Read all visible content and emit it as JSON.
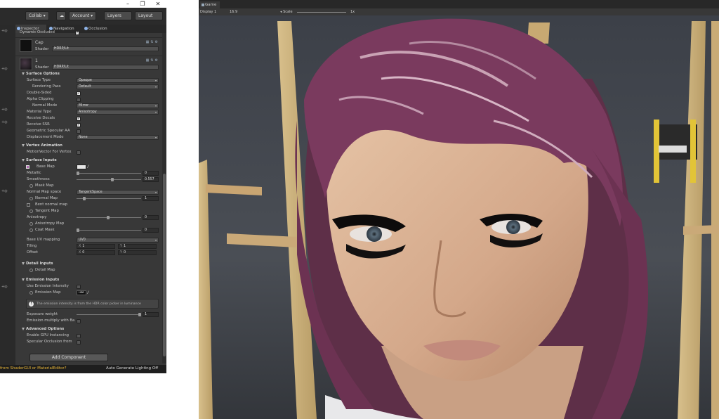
{
  "window": {
    "minimize_glyph": "–",
    "maximize_glyph": "❐",
    "close_glyph": "✕"
  },
  "toolbar": {
    "collab_label": "Collab ▾",
    "cloud_icon": "cloud-icon",
    "account_label": "Account ▾",
    "layers_label": "Layers",
    "layout_label": "Layout"
  },
  "tabs": [
    {
      "label": "Inspector",
      "icon": "info-icon"
    },
    {
      "label": "Navigation",
      "icon": "navigation-icon"
    },
    {
      "label": "Occlusion",
      "icon": "occlusion-icon"
    }
  ],
  "inspector": {
    "top_cut_label": "Dynamic Occluded",
    "materials": [
      {
        "name": "Cap",
        "shader_label": "Shader",
        "shader_value": "HDRP/Lit"
      },
      {
        "name": "1",
        "shader_label": "Shader",
        "shader_value": "HDRP/Lit"
      }
    ],
    "surface_options": {
      "title": "Surface Options",
      "surface_type_label": "Surface Type",
      "surface_type_value": "Opaque",
      "rendering_pass_label": "Rendering Pass",
      "rendering_pass_value": "Default",
      "double_sided_label": "Double-Sided",
      "alpha_clipping_label": "Alpha Clipping",
      "normal_mode_label": "Normal Mode",
      "normal_mode_value": "Mirror",
      "material_type_label": "Material Type",
      "material_type_value": "Anisotropy",
      "receive_decals_label": "Receive Decals",
      "receive_ssr_label": "Receive SSR",
      "geometric_specular_aa_label": "Geometric Specular AA",
      "displacement_mode_label": "Displacement Mode",
      "displacement_mode_value": "None"
    },
    "vertex_animation": {
      "title": "Vertex Animation",
      "motion_vector_label": "MotionVector For Vertex"
    },
    "surface_inputs": {
      "title": "Surface Inputs",
      "base_map_label": "Base Map",
      "metallic_label": "Metallic",
      "metallic_value": "0",
      "smoothness_label": "Smoothness",
      "smoothness_value": "0.557",
      "mask_map_label": "Mask Map",
      "normal_map_space_label": "Normal Map space",
      "normal_map_space_value": "TangentSpace",
      "normal_map_label": "Normal Map",
      "normal_map_value": "1",
      "bent_normal_map_label": "Bent normal map",
      "tangent_map_label": "Tangent Map",
      "anisotropy_label": "Anisotropy",
      "anisotropy_value": "0",
      "anisotropy_map_label": "Anisotropy Map",
      "coat_mask_label": "Coat Mask",
      "coat_mask_value": "0",
      "base_uv_mapping_label": "Base UV mapping",
      "base_uv_mapping_value": "UV0",
      "tiling_label": "Tiling",
      "tiling_x_key": "X",
      "tiling_x": "1",
      "tiling_y_key": "Y",
      "tiling_y": "1",
      "offset_label": "Offset",
      "offset_x_key": "X",
      "offset_x": "0",
      "offset_y_key": "Y",
      "offset_y": "0"
    },
    "detail_inputs": {
      "title": "Detail Inputs",
      "detail_map_label": "Detail Map"
    },
    "emission_inputs": {
      "title": "Emission Inputs",
      "use_emission_intensity_label": "Use Emission Intensity",
      "emission_map_label": "Emission Map",
      "hdr_badge": "HDR",
      "info_text": "The emission intensity is from the HDR color picker in luminance",
      "exposure_weight_label": "Exposure weight",
      "exposure_weight_value": "1",
      "emission_multiply_label": "Emission multiply with Ba"
    },
    "advanced_options": {
      "title": "Advanced Options",
      "gpu_instancing_label": "Enable GPU Instancing",
      "specular_occlusion_label": "Specular Occlusion from"
    },
    "add_component_label": "Add Component"
  },
  "status_bar": {
    "left_text": "from ShaderGUI or MaterialEditor?",
    "right_text": "Auto Generate Lighting Off"
  },
  "game_view": {
    "tab_label": "Game",
    "display_label": "Display 1",
    "aspect_label": "16:9",
    "scale_label": "Scale",
    "scale_value": "1x"
  },
  "colors": {
    "editor_bg": "#383838",
    "status_warning": "#e6b437",
    "hair": "#7a3a5e"
  }
}
